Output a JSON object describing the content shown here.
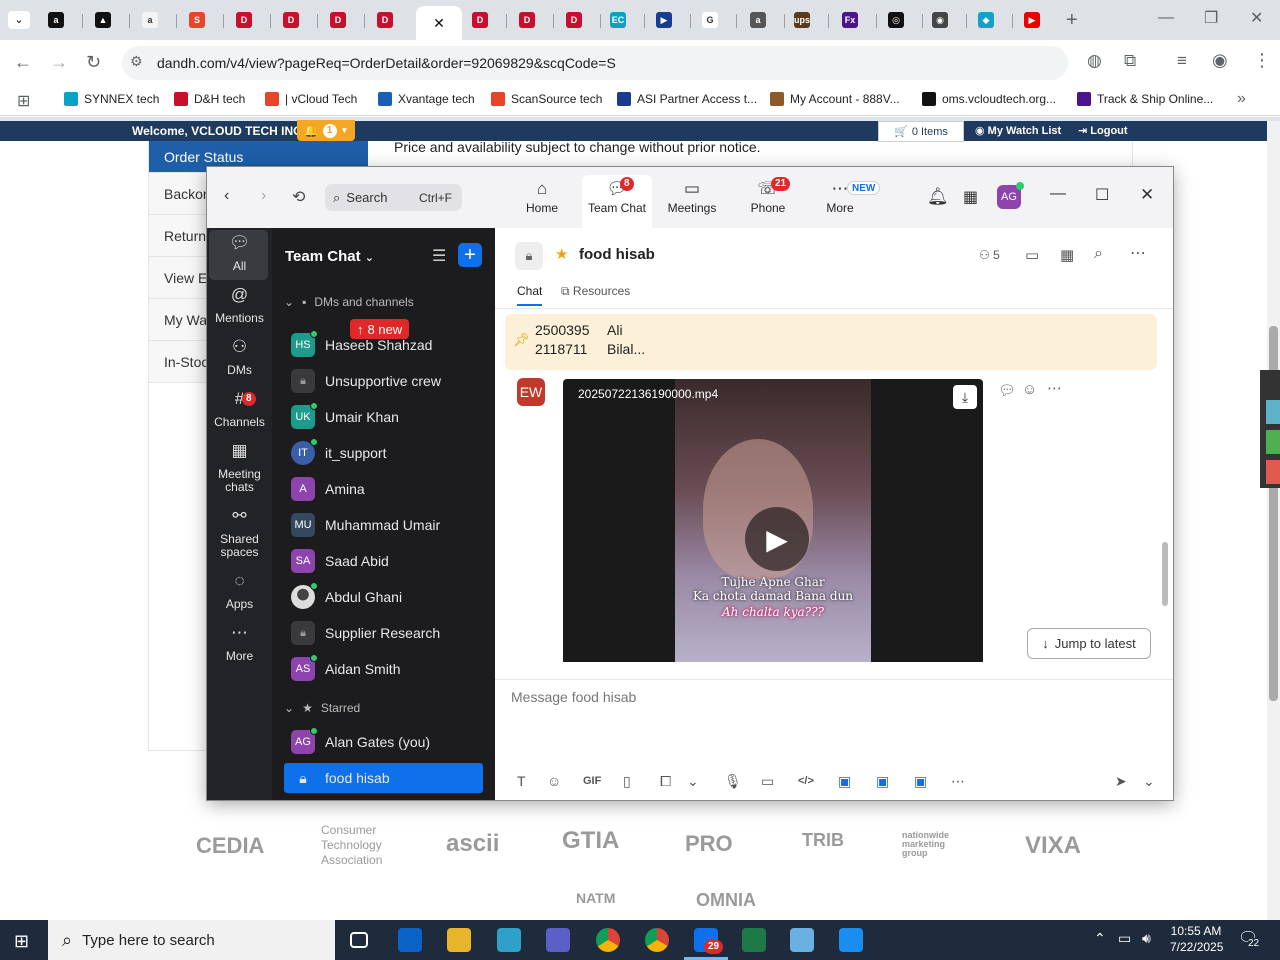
{
  "browser": {
    "url": "dandh.com/v4/view?pageReq=OrderDetail&order=92069829&scqCode=S",
    "bookmarks": [
      {
        "label": "SYNNEX tech",
        "color": "#0aa2c0"
      },
      {
        "label": "D&H tech",
        "color": "#c8102e"
      },
      {
        "label": "| vCloud Tech",
        "color": "#e8442a"
      },
      {
        "label": "Xvantage tech",
        "color": "#1a5fb4"
      },
      {
        "label": "ScanSource tech",
        "color": "#e8442a"
      },
      {
        "label": "ASI Partner Access t...",
        "color": "#1a3c8f"
      },
      {
        "label": "My Account - 888V...",
        "color": "#8a5a2b"
      },
      {
        "label": "oms.vcloudtech.org...",
        "color": "#111111"
      },
      {
        "label": "Track & Ship Online...",
        "color": "#4d148c"
      }
    ],
    "tab_favicons": [
      {
        "icon": "amazon-icon",
        "color": "#111",
        "glyph": "a"
      },
      {
        "icon": "triangle-icon",
        "color": "#111",
        "glyph": "▲"
      },
      {
        "icon": "amazon-icon",
        "color": "#f3f3f3",
        "glyph": "a"
      },
      {
        "icon": "scansource-icon",
        "color": "#e8442a",
        "glyph": "S"
      },
      {
        "icon": "dh-icon",
        "color": "#c8102e",
        "glyph": "D"
      },
      {
        "icon": "dh-icon",
        "color": "#c8102e",
        "glyph": "D"
      },
      {
        "icon": "dh-icon",
        "color": "#c8102e",
        "glyph": "D"
      },
      {
        "icon": "dh-icon",
        "color": "#c8102e",
        "glyph": "D"
      },
      {
        "icon": "close-icon",
        "color": "#fff",
        "glyph": "✕"
      },
      {
        "icon": "dh-icon",
        "color": "#c8102e",
        "glyph": "D"
      },
      {
        "icon": "dh-icon",
        "color": "#c8102e",
        "glyph": "D"
      },
      {
        "icon": "dh-icon",
        "color": "#c8102e",
        "glyph": "D"
      },
      {
        "icon": "synnex-icon",
        "color": "#0aa2c0",
        "glyph": "EC"
      },
      {
        "icon": "asi-icon",
        "color": "#1a3c8f",
        "glyph": "▶"
      },
      {
        "icon": "google-icon",
        "color": "#fff",
        "glyph": "G"
      },
      {
        "icon": "amazon-icon",
        "color": "#555",
        "glyph": "a"
      },
      {
        "icon": "ups-icon",
        "color": "#5a3a1a",
        "glyph": "ups"
      },
      {
        "icon": "fedex-icon",
        "color": "#4d148c",
        "glyph": "Fx"
      },
      {
        "icon": "openai-icon",
        "color": "#111",
        "glyph": "◎"
      },
      {
        "icon": "game-icon",
        "color": "#444",
        "glyph": "◉"
      },
      {
        "icon": "edge-icon",
        "color": "#14a0c8",
        "glyph": "◆"
      },
      {
        "icon": "youtube-icon",
        "color": "#e00",
        "glyph": "▶"
      }
    ]
  },
  "site": {
    "welcome": "Welcome, VCLOUD TECH INC",
    "alert_count": "1",
    "cart": "0 Items",
    "watch_list": "My Watch List",
    "logout": "Logout",
    "notice": "Price and availability subject to change without prior notice.",
    "menu": [
      "Order Status",
      "Backor",
      "Return",
      "View E",
      "My Wat",
      "In-Stoc"
    ],
    "logos": [
      "CEDIA",
      "Consumer",
      "Technology",
      "Association",
      "ascii",
      "GTIA",
      "PRO",
      "TRIB",
      "nationwide",
      "marketing",
      "group",
      "VIXA",
      "NATM",
      "OMNIA"
    ]
  },
  "zoom": {
    "search_label": "Search",
    "search_shortcut": "Ctrl+F",
    "nav": [
      {
        "label": "Home",
        "icon": "home-icon",
        "badge": ""
      },
      {
        "label": "Team Chat",
        "icon": "chat-icon",
        "badge": "8"
      },
      {
        "label": "Meetings",
        "icon": "video-icon",
        "badge": ""
      },
      {
        "label": "Phone",
        "icon": "phone-icon",
        "badge": "21"
      },
      {
        "label": "More",
        "icon": "more-icon",
        "badge": "NEW"
      }
    ],
    "user_initials": "AG",
    "rail": [
      {
        "label": "All",
        "icon": "chat-icon",
        "badge": ""
      },
      {
        "label": "Mentions",
        "icon": "at-icon",
        "badge": ""
      },
      {
        "label": "DMs",
        "icon": "people-icon",
        "badge": ""
      },
      {
        "label": "Channels",
        "icon": "hash-icon",
        "badge": "8"
      },
      {
        "label": "Meeting",
        "label2": "chats",
        "icon": "calendar-icon",
        "badge": ""
      },
      {
        "label": "Shared",
        "label2": "spaces",
        "icon": "share-icon",
        "badge": ""
      },
      {
        "label": "Apps",
        "icon": "apps-icon",
        "badge": ""
      },
      {
        "label": "More",
        "icon": "more-icon",
        "badge": ""
      }
    ],
    "list_title": "Team Chat",
    "section_dms": "DMs and channels",
    "new_badge": "8 new",
    "contacts": [
      {
        "initials": "HS",
        "name": "Haseeb Shahzad",
        "color": "#1e9b8a",
        "online": true
      },
      {
        "initials": "",
        "name": "Unsupportive crew",
        "color": "#3a3a3e",
        "online": false,
        "lock": true
      },
      {
        "initials": "UK",
        "name": "Umair Khan",
        "color": "#1e9b8a",
        "online": true
      },
      {
        "initials": "IT",
        "name": "it_support",
        "color": "#3a5ea8",
        "online": true
      },
      {
        "initials": "A",
        "name": "Amina",
        "color": "#8e44ad",
        "online": false
      },
      {
        "initials": "MU",
        "name": "Muhammad Umair",
        "color": "#34495e",
        "online": false
      },
      {
        "initials": "SA",
        "name": "Saad Abid",
        "color": "#8e44ad",
        "online": false
      },
      {
        "initials": "",
        "name": "Abdul Ghani",
        "color": "#dddddd",
        "online": true
      },
      {
        "initials": "",
        "name": "Supplier Research",
        "color": "#3a3a3e",
        "online": false,
        "lock": true
      },
      {
        "initials": "AS",
        "name": "Aidan Smith",
        "color": "#8e44ad",
        "online": true
      }
    ],
    "section_starred": "Starred",
    "starred": [
      {
        "initials": "AG",
        "name": "Alan Gates (you)",
        "color": "#8e44ad",
        "online": true
      }
    ],
    "selected_channel": "food hisab",
    "channel_title": "food hisab",
    "member_count": "5",
    "tabs": [
      "Chat",
      "Resources"
    ],
    "pinned_lines": [
      [
        "2500395",
        "Ali"
      ],
      [
        "2118711",
        "Bilal..."
      ]
    ],
    "sender_initials": "EW",
    "video_file": "20250722136190000.mp4",
    "video_caption": [
      "Tujhe Apne Ghar",
      "Ka chota damad Bana dun",
      "Ah chalta kya???"
    ],
    "jump_label": "Jump to latest",
    "compose_placeholder": "Message food hisab"
  },
  "taskbar": {
    "search": "Type here to search",
    "time": "10:55 AM",
    "date": "7/22/2025",
    "notif_count": "22",
    "zoom_badge": "29"
  }
}
